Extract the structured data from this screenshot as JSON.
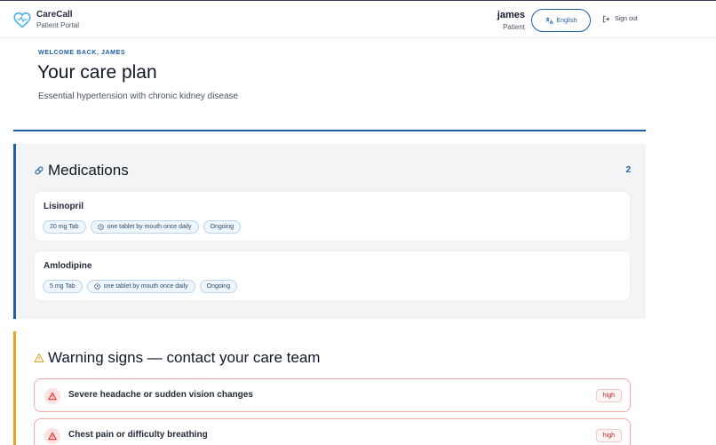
{
  "brand": {
    "name": "CareCall",
    "subtitle": "Patient Portal"
  },
  "user": {
    "name": "james",
    "role": "Patient"
  },
  "language_button": {
    "label": "English"
  },
  "signout": {
    "label": "Sign out"
  },
  "page": {
    "welcome": "WELCOME BACK, JAMES",
    "title": "Your care plan",
    "diagnosis": "Essential hypertension with chronic kidney disease"
  },
  "medications": {
    "heading": "Medications",
    "count": "2",
    "items": [
      {
        "name": "Lisinopril",
        "dose": "20 mg Tab",
        "instructions": "one tablet by mouth once daily",
        "status": "Ongoing"
      },
      {
        "name": "Amlodipine",
        "dose": "5 mg Tab",
        "instructions": "one tablet by mouth once daily",
        "status": "Ongoing"
      }
    ]
  },
  "warnings": {
    "heading": "Warning signs — contact your care team",
    "items": [
      {
        "text": "Severe headache or sudden vision changes",
        "severity": "high"
      },
      {
        "text": "Chest pain or difficulty breathing",
        "severity": "high"
      }
    ]
  },
  "colors": {
    "accent": "#1e5fa8",
    "warning_accent": "#e0a323",
    "danger": "#b91c1c",
    "heart_logo": "#4fb3e8"
  },
  "icons": {
    "logo": "heart-logo-icon",
    "language": "translate-icon",
    "signout": "logout-icon",
    "medications": "pill-icon",
    "instructions": "clock-icon",
    "warnings": "warning-triangle-icon",
    "warning_item": "alert-triangle-icon"
  }
}
